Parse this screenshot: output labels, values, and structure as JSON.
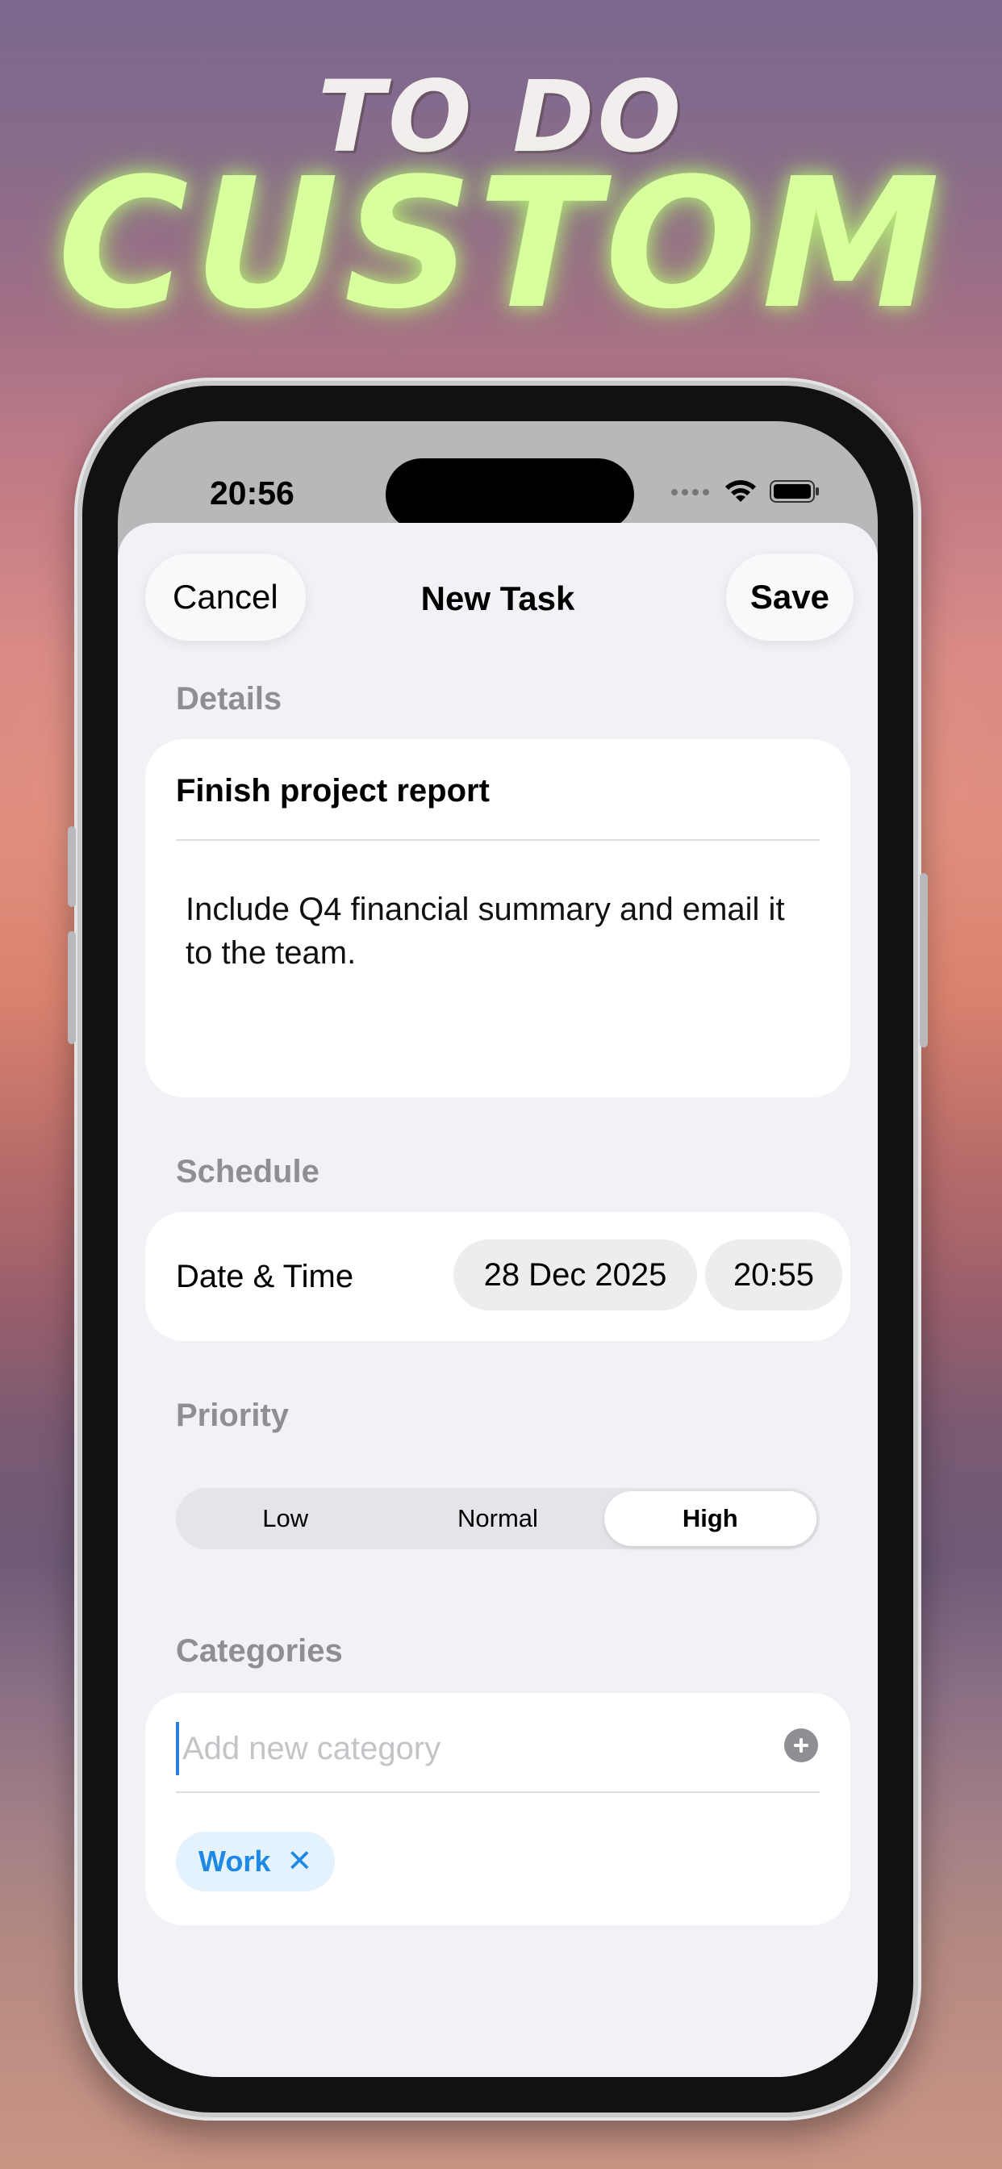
{
  "promo": {
    "line1": "TO DO",
    "line2": "CUSTOM"
  },
  "status_bar": {
    "time": "20:56"
  },
  "nav": {
    "cancel_label": "Cancel",
    "title": "New Task",
    "save_label": "Save"
  },
  "details": {
    "section_title": "Details",
    "task_title": "Finish project report",
    "notes": "Include Q4 financial summary and email it to the team."
  },
  "schedule": {
    "section_title": "Schedule",
    "label": "Date & Time",
    "date": "28 Dec 2025",
    "time": "20:55"
  },
  "priority": {
    "section_title": "Priority",
    "options": [
      "Low",
      "Normal",
      "High"
    ],
    "selected": "High"
  },
  "categories": {
    "section_title": "Categories",
    "input_placeholder": "Add new category",
    "input_value": "",
    "add_icon": "plus-circle-icon",
    "tags": [
      {
        "label": "Work",
        "remove_icon": "close-icon"
      }
    ]
  },
  "colors": {
    "accent_green": "#d8ff9e",
    "chip_blue": "#1e88e5",
    "chip_bg": "#e3f2fd",
    "sheet_bg": "#f2f1f6",
    "secondary_text": "#8e8e93"
  }
}
